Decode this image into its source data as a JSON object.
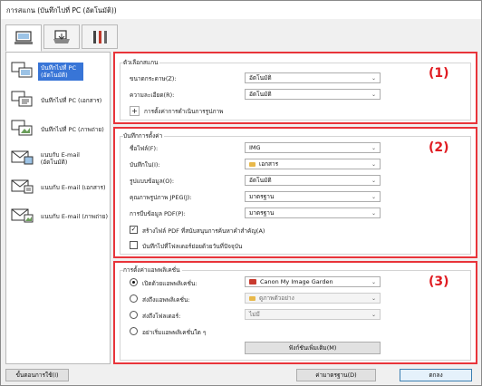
{
  "window": {
    "title": "การสแกน (บันทึกไปที่ PC (อัตโนมัติ))"
  },
  "tabs": [
    {
      "icon": "scan-from-computer-icon"
    },
    {
      "icon": "scan-from-operation-panel-icon"
    },
    {
      "icon": "general-settings-tools-icon"
    }
  ],
  "sidebar": {
    "items": [
      {
        "label": "บันทึกไปที่ PC (อัตโนมัติ)",
        "icon": "pc-auto-icon"
      },
      {
        "label": "บันทึกไปที่ PC (เอกสาร)",
        "icon": "pc-document-icon"
      },
      {
        "label": "บันทึกไปที่ PC (ภาพถ่าย)",
        "icon": "pc-photo-icon"
      },
      {
        "label": "แนบกับ E-mail (อัตโนมัติ)",
        "icon": "email-auto-icon"
      },
      {
        "label": "แนบกับ E-mail (เอกสาร)",
        "icon": "email-document-icon"
      },
      {
        "label": "แนบกับ E-mail (ภาพถ่าย)",
        "icon": "email-photo-icon"
      }
    ]
  },
  "scan_options": {
    "title": "ตัวเลือกสแกน",
    "number": "(1)",
    "paper_size_label": "ขนาดกระดาษ(Z):",
    "paper_size_value": "อัตโนมัติ",
    "resolution_label": "ความละเอียด(R):",
    "resolution_value": "อัตโนมัติ",
    "image_processing_label": "การตั้งค่าการดำเนินการรูปภาพ"
  },
  "save_settings": {
    "title": "บันทึกการตั้งค่า",
    "number": "(2)",
    "file_name_label": "ชื่อไฟล์(F):",
    "file_name_value": "IMG",
    "save_in_label": "บันทึกใน(I):",
    "save_in_value": "เอกสาร",
    "data_format_label": "รูปแบบข้อมูล(O):",
    "data_format_value": "อัตโนมัติ",
    "jpeg_quality_label": "คุณภาพรูปภาพ JPEG(J):",
    "jpeg_quality_value": "มาตรฐาน",
    "pdf_compression_label": "การบีบข้อมูล PDF(P):",
    "pdf_compression_value": "มาตรฐาน",
    "searchable_pdf_label": "สร้างไฟล์ PDF ที่สนับสนุนการค้นหาคำสำคัญ(A)",
    "searchable_pdf_checked": "✓",
    "subfolder_label": "บันทึกไปที่โฟลเดอร์ย่อยด้วยวันที่ปัจจุบัน"
  },
  "app_settings": {
    "title": "การตั้งค่าแอพพลิเคชั่น",
    "number": "(3)",
    "open_app_label": "เปิดด้วยแอพพลิเคชั่น:",
    "open_app_value": "Canon My Image Garden",
    "send_app_label": "ส่งถึงแอพพลิเคชั่น:",
    "send_app_value": "ดูภาพตัวอย่าง",
    "send_folder_label": "ส่งถึงโฟลเดอร์:",
    "send_folder_value": "ไม่มี",
    "no_app_label": "อย่าเริ่มแอพพลิเคชั่นใด ๆ",
    "more_functions_label": "ฟังก์ชันเพิ่มเติม(M)"
  },
  "footer": {
    "instructions_label": "ขั้นตอนการใช้(I)",
    "defaults_label": "ค่ามาตรฐาน(D)",
    "ok_label": "ตกลง"
  },
  "colors": {
    "highlight": "#e8343a",
    "number": "#e01c22",
    "selection": "#3875d7"
  }
}
